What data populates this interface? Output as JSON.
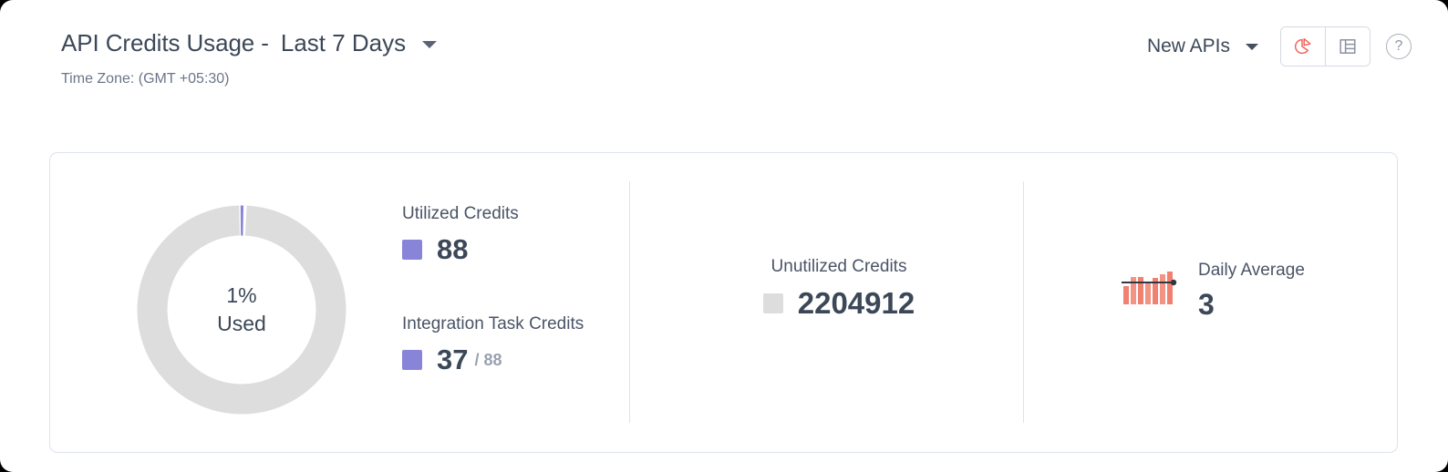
{
  "header": {
    "title_main": "API Credits Usage -",
    "period_label": "Last 7 Days",
    "period_caret": "chevron-down-icon",
    "timezone": "Time Zone: (GMT +05:30)",
    "api_scope_label": "New APIs",
    "view_toggle": [
      {
        "name": "pie-chart-view",
        "label": "Chart View",
        "active": true,
        "color": "#f0675c"
      },
      {
        "name": "table-view",
        "label": "Table View",
        "active": false,
        "color": "#8a92a0"
      }
    ],
    "help_label": "?"
  },
  "card": {
    "donut": {
      "percent_text": "1%",
      "used_text": "Used",
      "used_percent": 1,
      "used_color": "#8884d8",
      "track_color": "#dddddd"
    },
    "stats": [
      {
        "label": "Utilized Credits",
        "value": "88",
        "denominator": null,
        "swatch_color": "#8884d8"
      },
      {
        "label": "Integration Task Credits",
        "value": "37",
        "denominator": "/ 88",
        "swatch_color": "#8884d8"
      },
      {
        "label": "Unutilized Credits",
        "value": "2204912",
        "denominator": null,
        "swatch_color": "#dddddd"
      },
      {
        "label": "Daily Average",
        "value": "3",
        "denominator": null,
        "swatch_color": "#f0806f"
      }
    ]
  },
  "chart_data": [
    {
      "type": "pie",
      "title": "API Credits Usage",
      "labels": [
        "Utilized Credits",
        "Unutilized Credits"
      ],
      "values": [
        88,
        2204912
      ],
      "colors": [
        "#8884d8",
        "#dddddd"
      ],
      "center_label": "1% Used",
      "legend": "right"
    },
    {
      "type": "bar",
      "title": "Daily Average",
      "categories": [
        "1",
        "2",
        "3",
        "4",
        "5",
        "6",
        "7"
      ],
      "values": [
        2,
        4,
        4,
        3,
        4,
        4.5,
        5
      ],
      "average_line": 3,
      "bar_color": "#f0806f",
      "line_color": "#32373f",
      "xlabel": "",
      "ylabel": "",
      "ylim": [
        0,
        5
      ]
    }
  ]
}
